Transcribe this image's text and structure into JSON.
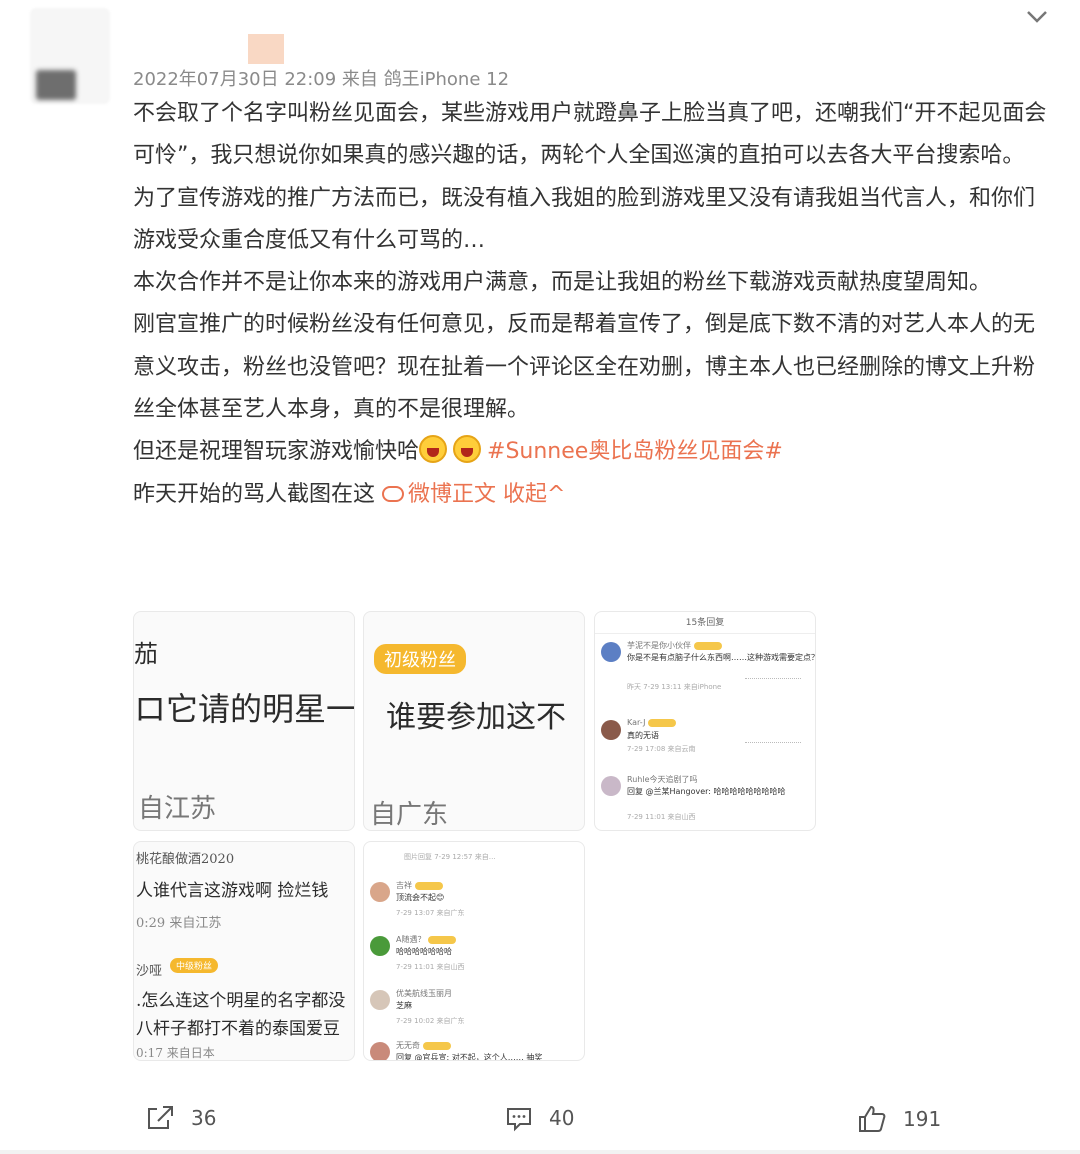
{
  "post": {
    "meta": "2022年07月30日 22:09  来自 鸽王iPhone 12",
    "paragraphs": [
      "不会取了个名字叫粉丝见面会，某些游戏用户就蹬鼻子上脸当真了吧，还嘲我们“开不起见面会可怜”，我只想说你如果真的感兴趣的话，两轮个人全国巡演的直拍可以去各大平台搜索哈。",
      "为了宣传游戏的推广方法而已，既没有植入我姐的脸到游戏里又没有请我姐当代言人，和你们游戏受众重合度低又有什么可骂的…",
      "本次合作并不是让你本来的游戏用户满意，而是让我姐的粉丝下载游戏贡献热度望周知。",
      "刚官宣推广的时候粉丝没有任何意见，反而是帮着宣传了，倒是底下数不清的对艺人本人的无意义攻击，粉丝也没管吧？现在扯着一个评论区全在劝删，博主本人也已经删除的博文上升粉丝全体甚至艺人本身，真的不是很理解。"
    ],
    "line5_prefix": "但还是祝理智玩家游戏愉快哈",
    "hashtag": "#Sunnee奥比岛粉丝见面会#",
    "line6_prefix": "昨天开始的骂人截图在这",
    "source_link": "微博正文",
    "collapse_link": "收起^"
  },
  "thumbs": {
    "t1": {
      "top": "茄",
      "main": "ロ它请的明星一",
      "bottom": "自江苏"
    },
    "t2": {
      "badge": "初级粉丝",
      "main": "谁要参加这不",
      "bottom": "自广东"
    },
    "t3": {
      "title": "15条回复",
      "rows": [
        {
          "name": "芋泥不是你小伙伴",
          "text": "你是不是有点脑子什么东西啊……这种游戏需要定点？",
          "meta": "昨天 7-29 13:11 来自iPhone"
        },
        {
          "name": "Kar-J",
          "text": "真的无语",
          "meta": "7-29 17:08 来自云南"
        },
        {
          "name": "Ruhle今天追剧了吗",
          "text": "回复 @兰某Hangover: 哈哈哈哈哈哈哈哈哈",
          "meta": "7-29 11:01 来自山西"
        }
      ]
    },
    "t4": {
      "l1": "桃花酿做酒2020",
      "l2": "人谁代言这游戏啊 捡烂钱",
      "l3": "0:29 来自江苏",
      "l4": "沙哑",
      "badge": "中级粉丝",
      "l5": ".怎么连这个明星的名字都没",
      "l6": "八杆子都打不着的泰国爱豆",
      "l7": "0:17 来自日本"
    },
    "t5": {
      "header": "图片回复 7-29 12:57 来自…",
      "rows": [
        {
          "name": "吉祥",
          "text": "顶流会不起😊",
          "meta": "7-29 13:07 来自广东"
        },
        {
          "name": "A随遇？",
          "text": "哈哈哈哈哈哈哈",
          "meta": "7-29 11:01 来自山西"
        },
        {
          "name": "优美航线玉丽月",
          "text": "芝麻",
          "meta": "7-29 10:02 来自广东"
        },
        {
          "name": "无无奇",
          "text": "回复 @官兵宣: 对不起，这个人…… 抽奖",
          "meta": ""
        }
      ]
    }
  },
  "actions": {
    "share": "36",
    "comment": "40",
    "like": "191"
  }
}
